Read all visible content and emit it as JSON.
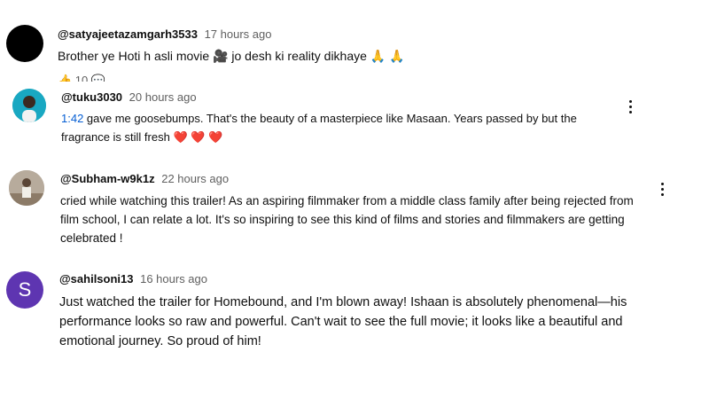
{
  "comments": [
    {
      "handle": "@satyajeetazamgarh3533",
      "time": "17 hours ago",
      "text": "Brother ye Hoti h asli movie 🎥 jo desh ki reality dikhaye 🙏 🙏",
      "avatar_color": "#000000",
      "partial_actions": "👍 10  💬"
    },
    {
      "handle": "@tuku3030",
      "time": "20 hours ago",
      "timestamp_link": "1:42",
      "text": " gave me goosebumps. That's the beauty of a masterpiece like Masaan. Years passed by but the fragrance is still fresh",
      "hearts": "❤️ ❤️ ❤️",
      "avatar_color": "#1aa6b7"
    },
    {
      "handle": "@Subham-w9k1z",
      "time": "22 hours ago",
      "text": "cried while watching this trailer! As an aspiring filmmaker from a middle class family after being rejected from film school, I can relate a lot.  It's so inspiring to see this kind of films and stories and filmmakers are getting celebrated !",
      "avatar_color": "#a09080"
    },
    {
      "handle": "@sahilsoni13",
      "time": "16 hours ago",
      "text": "Just watched the trailer for Homebound, and I'm blown away! Ishaan is absolutely phenomenal—his performance looks so raw and powerful. Can't wait to see the full movie; it looks like a beautiful and emotional journey. So proud of him!",
      "avatar_letter": "S",
      "avatar_color": "#5e35b1"
    }
  ]
}
